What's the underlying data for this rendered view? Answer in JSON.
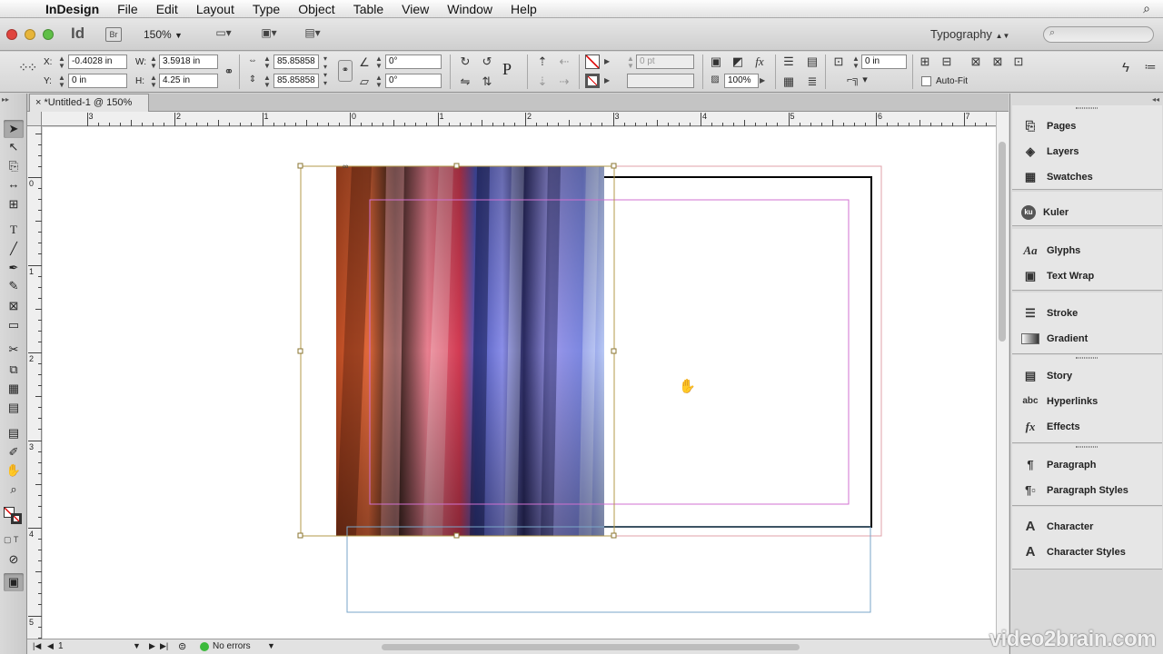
{
  "menubar": {
    "apple": "",
    "app_name": "InDesign",
    "items": [
      "File",
      "Edit",
      "Layout",
      "Type",
      "Object",
      "Table",
      "View",
      "Window",
      "Help"
    ]
  },
  "appbar": {
    "logo": "Id",
    "bridge": "Br",
    "zoom": "150%",
    "workspace": "Typography"
  },
  "control": {
    "x_label": "X:",
    "x_value": "-0.4028 in",
    "y_label": "Y:",
    "y_value": "0 in",
    "w_label": "W:",
    "w_value": "3.5918 in",
    "h_label": "H:",
    "h_value": "4.25 in",
    "scale_x": "85.85858",
    "scale_y": "85.85858",
    "rotate": "0°",
    "shear": "0°",
    "stroke_weight": "0 pt",
    "opacity": "100%",
    "offset": "0 in",
    "autofit": "Auto-Fit"
  },
  "document": {
    "tab_title": "*Untitled-1 @ 150%"
  },
  "ruler": {
    "h_labels": [
      "3",
      "2",
      "1",
      "0",
      "1",
      "2",
      "3",
      "4",
      "5",
      "6",
      "7"
    ],
    "v_labels": [
      "0",
      "1",
      "2",
      "3",
      "4",
      "5"
    ]
  },
  "status": {
    "page": "1",
    "preflight": "No errors"
  },
  "panels": {
    "items": [
      "Pages",
      "Layers",
      "Swatches",
      "Kuler",
      "Glyphs",
      "Text Wrap",
      "Stroke",
      "Gradient",
      "Story",
      "Hyperlinks",
      "Effects",
      "Paragraph",
      "Paragraph Styles",
      "Character",
      "Character Styles"
    ]
  },
  "watermark": "video2brain.com",
  "colors": {
    "selection": "#b39a4a",
    "margin": "#d070d0",
    "bleed": "#e0a0a8",
    "frame": "#7aa6c8"
  }
}
